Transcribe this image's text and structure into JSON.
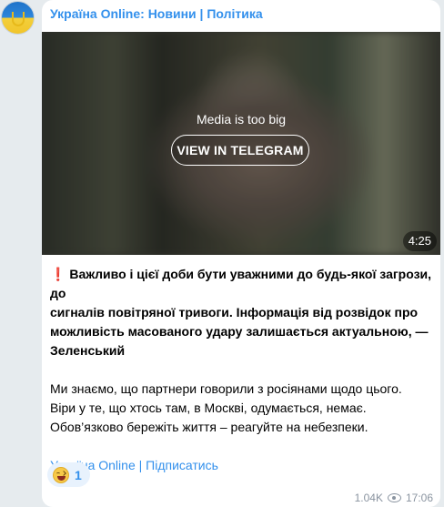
{
  "channel": {
    "name": "Україна Online: Новини | Політика",
    "avatar_icon": "ukraine-flag-trident-icon"
  },
  "media": {
    "notice": "Media is too big",
    "view_button": "VIEW IN TELEGRAM",
    "duration": "4:25"
  },
  "message": {
    "lead_emoji": "❗",
    "lead_lines": [
      "Важливо і цієї доби бути уважними до будь-якої загрози, до",
      "сигналів повітряної тривоги. Інформація від розвідок про",
      "можливість масованого удару залишається актуальною, —",
      "Зеленський"
    ],
    "body_lines": [
      "Ми знаємо, що партнери говорили з росіянами щодо цього.",
      "Віри у те, що хтось там, в Москві, одумається, немає.",
      "Обов’язково бережіть життя – реагуйте на небезпеки."
    ],
    "link_channel": "Україна Online",
    "link_separator": " | ",
    "link_subscribe": "Підписатись"
  },
  "reaction": {
    "emoji": "grinning-face-with-tongue",
    "count": "1"
  },
  "footer": {
    "views": "1.04K",
    "views_icon": "eye-icon",
    "time": "17:06"
  },
  "colors": {
    "accent": "#3390ec",
    "background": "#e6ebee",
    "bubble": "#ffffff"
  }
}
